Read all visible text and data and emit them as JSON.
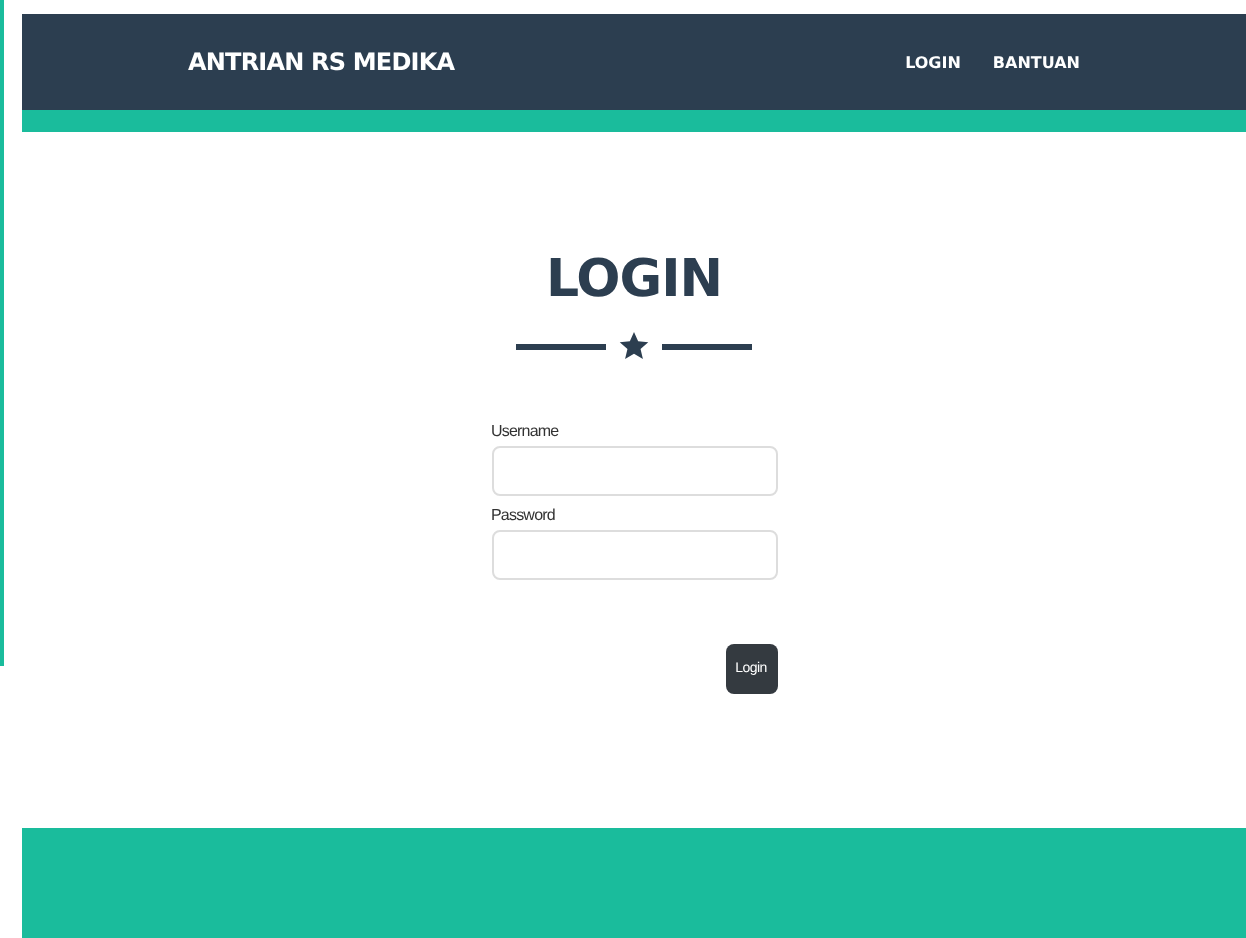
{
  "navbar": {
    "brand": "ANTRIAN RS MEDIKA",
    "links": [
      {
        "label": "LOGIN"
      },
      {
        "label": "BANTUAN"
      }
    ]
  },
  "login": {
    "title": "LOGIN",
    "fields": [
      {
        "label": "Username"
      },
      {
        "label": "Password"
      }
    ],
    "submit": "Login"
  }
}
